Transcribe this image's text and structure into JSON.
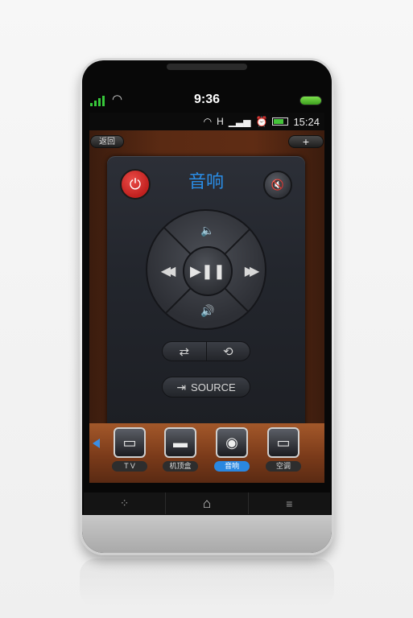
{
  "outer_status": {
    "time": "9:36",
    "wifi_icon": "wifi-icon"
  },
  "android_status": {
    "time": "15:24",
    "icons": [
      "wifi-icon",
      "h-signal-icon",
      "signal-bars-icon",
      "alarm-icon",
      "battery-icon"
    ]
  },
  "header": {
    "back_label": "返回",
    "add_label": "+"
  },
  "remote": {
    "title": "音响",
    "power_glyph": "⏻",
    "mute_glyph": "🔇",
    "dpad": {
      "up_glyph": "🔈",
      "down_glyph": "🔊",
      "left_glyph": "◀◀",
      "right_glyph": "▶▶",
      "center_glyph": "▶❚❚"
    },
    "shuffle_glyph": "⇄",
    "repeat_glyph": "⟲",
    "source_label": "SOURCE",
    "source_glyph": "⇥"
  },
  "devices": [
    {
      "label": "T V",
      "glyph": "▭",
      "icon": "tv-icon",
      "active": false
    },
    {
      "label": "机顶盒",
      "glyph": "▬",
      "icon": "set-top-box-icon",
      "active": false
    },
    {
      "label": "音响",
      "glyph": "◉",
      "icon": "speaker-icon",
      "active": true
    },
    {
      "label": "空调",
      "glyph": "▭",
      "icon": "air-conditioner-icon",
      "active": false
    }
  ],
  "nav": {
    "recent_glyph": "⁘",
    "home_glyph": "⌂",
    "menu_glyph": "≡"
  }
}
